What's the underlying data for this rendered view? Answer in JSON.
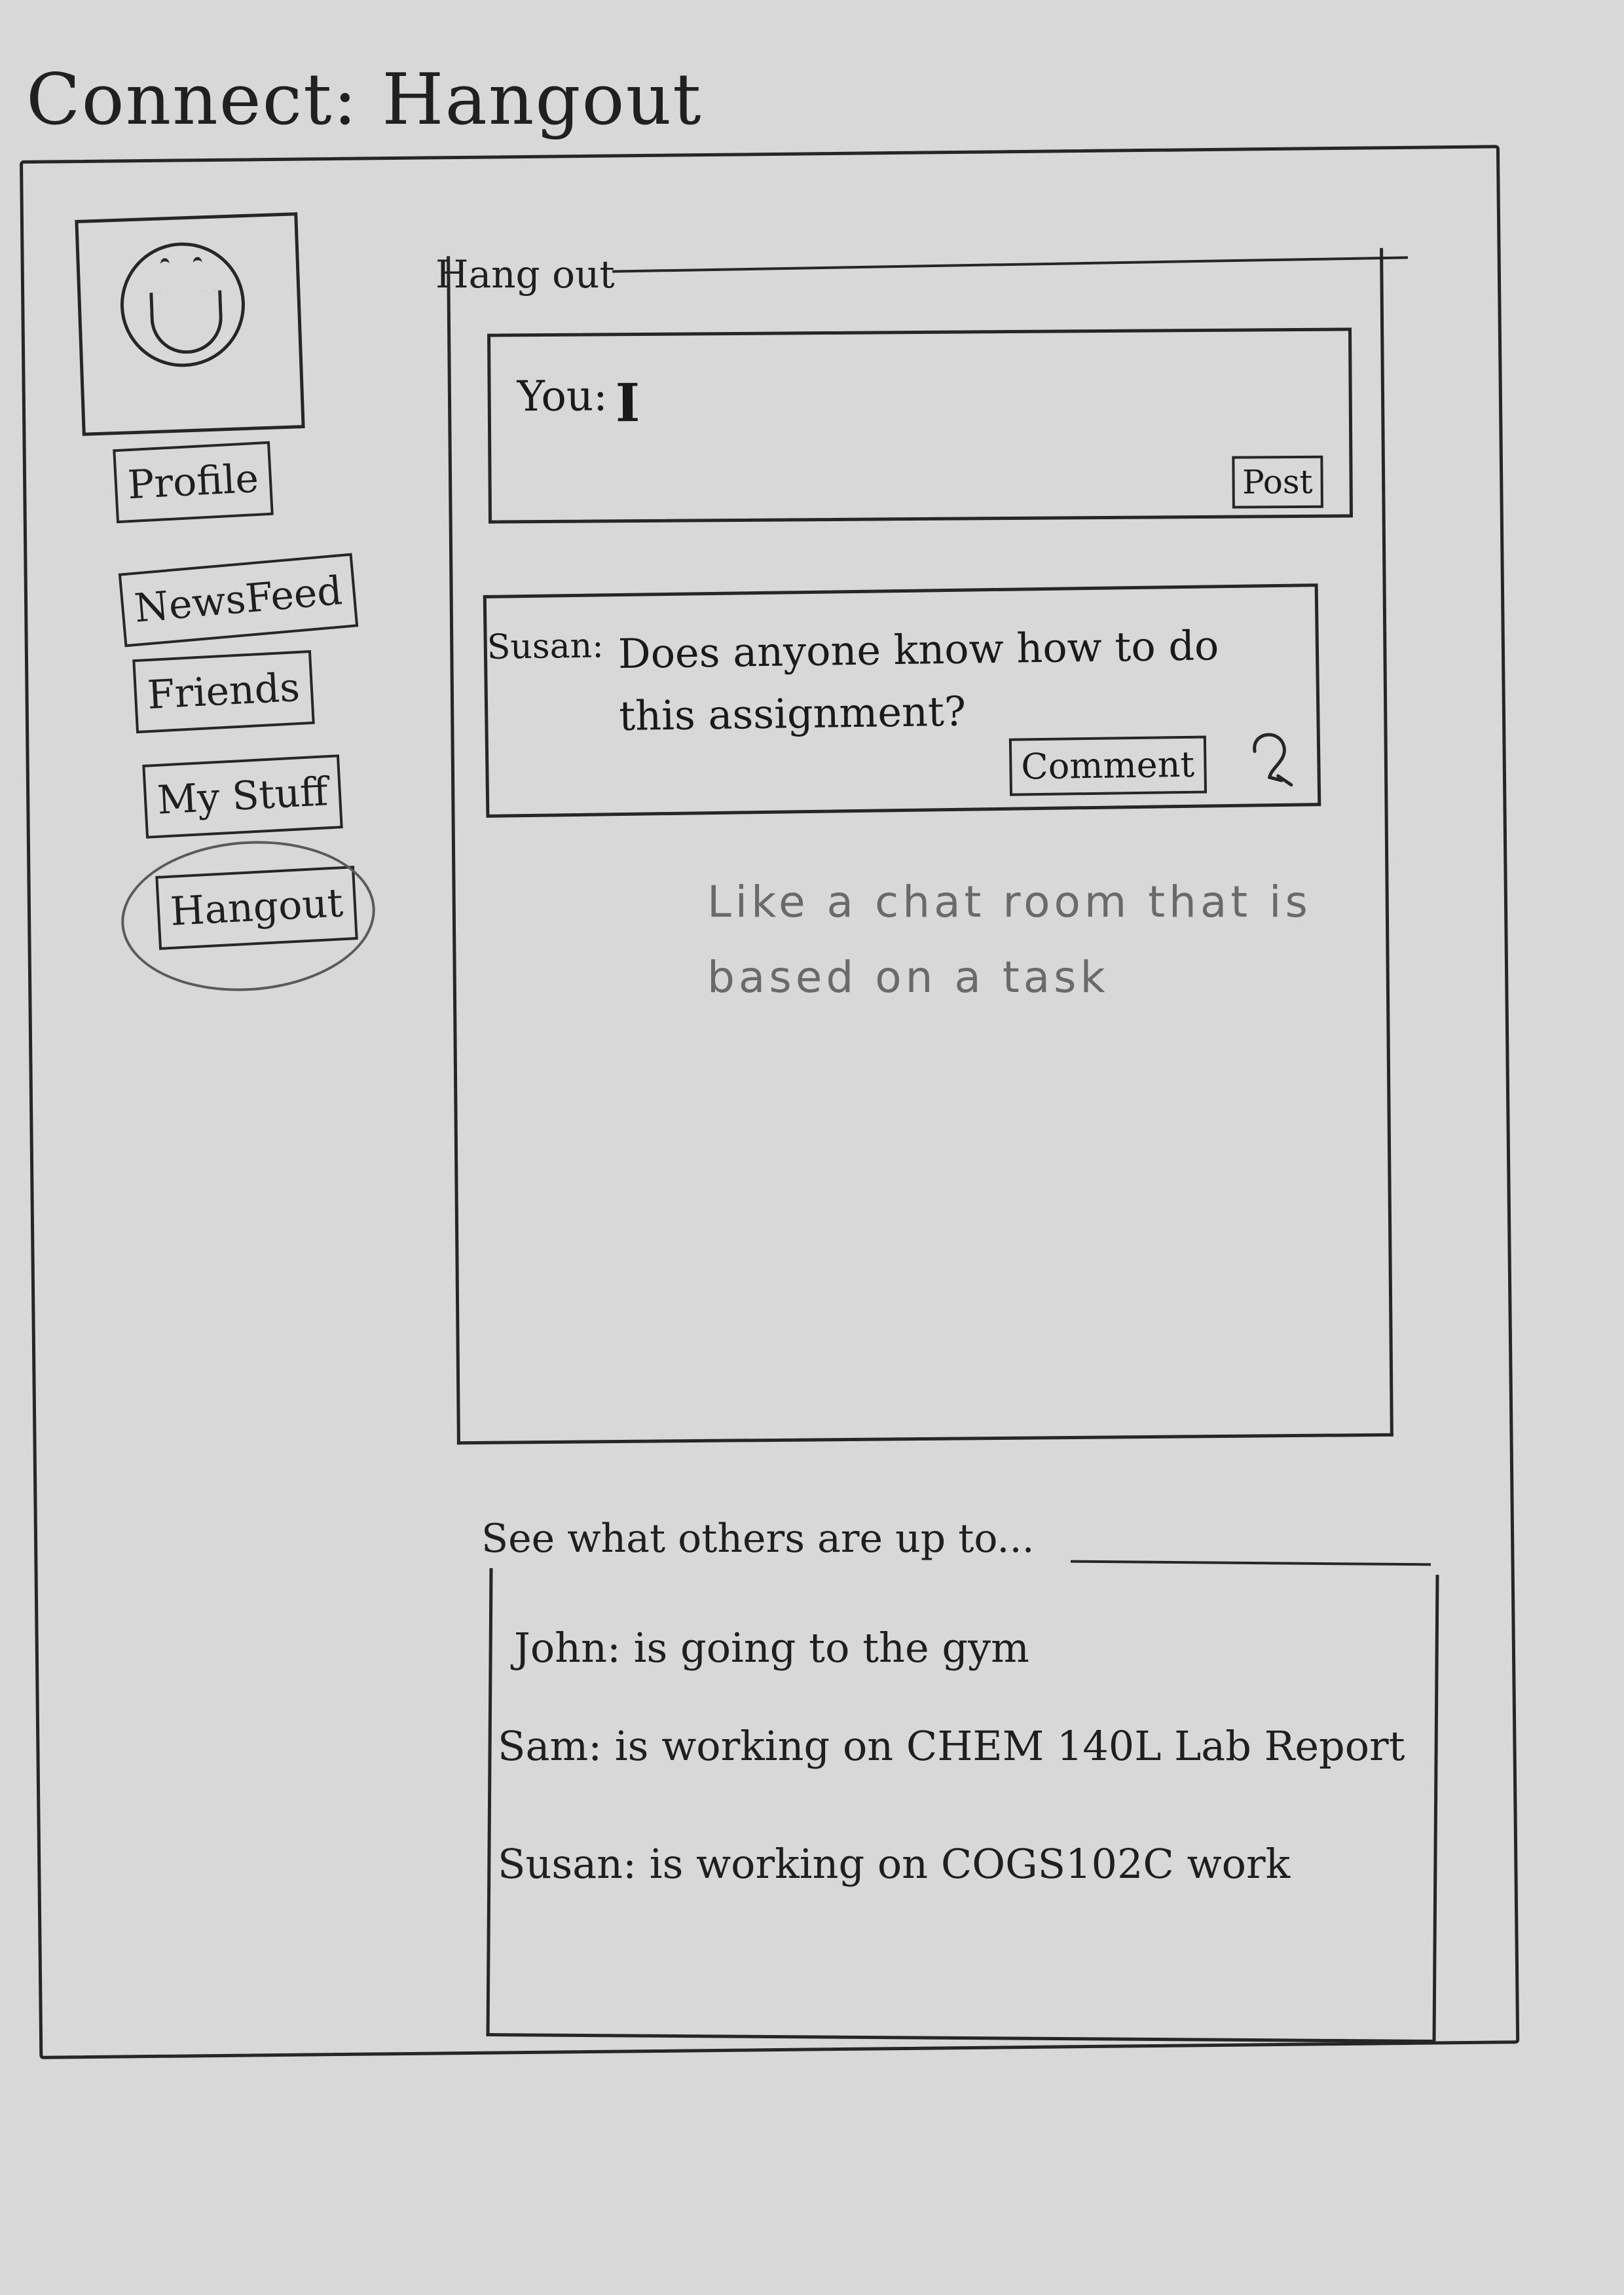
{
  "app": {
    "title": "Connect: Hangout"
  },
  "sidebar": {
    "avatar_icon": "smiley-face-icon",
    "items": [
      {
        "label": "Profile"
      },
      {
        "label": "NewsFeed"
      },
      {
        "label": "Friends"
      },
      {
        "label": "My Stuff"
      },
      {
        "label": "Hangout",
        "selected": true
      }
    ]
  },
  "hangout": {
    "heading": "Hang out",
    "compose": {
      "label": "You:",
      "value": "",
      "post_label": "Post"
    },
    "messages": [
      {
        "author": "Susan:",
        "text": "Does anyone know how to do this assignment?",
        "comment_label": "Comment",
        "reply_icon": "reply-icon"
      }
    ],
    "note": "Like a chat room that is based on a task"
  },
  "activity": {
    "heading": "See what others are up to...",
    "items": [
      {
        "name": "John:",
        "status": "is going to the gym"
      },
      {
        "name": "Sam:",
        "status": "is working on CHEM 140L Lab Report"
      },
      {
        "name": "Susan:",
        "status": "is working on COGS102C work"
      }
    ]
  }
}
